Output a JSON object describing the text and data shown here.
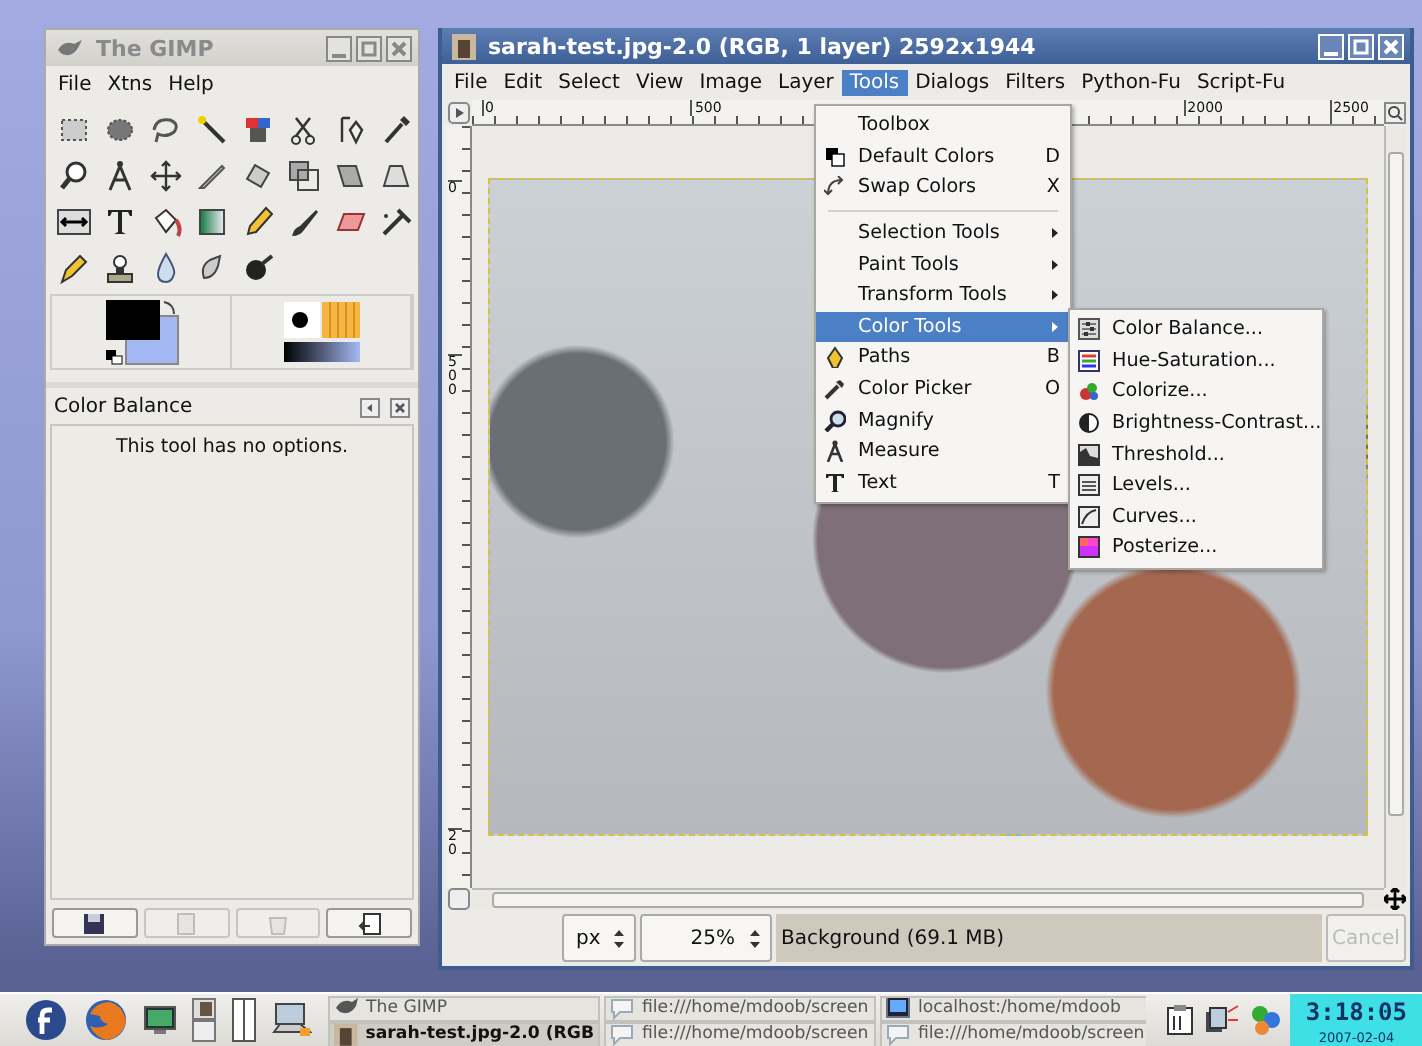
{
  "toolbox": {
    "title": "The GIMP",
    "menu": [
      "File",
      "Xtns",
      "Help"
    ],
    "options_panel": {
      "title": "Color Balance",
      "message": "This tool has no options."
    },
    "buttons": [
      {
        "disabled": false
      },
      {
        "disabled": true
      },
      {
        "disabled": true
      },
      {
        "disabled": false
      }
    ]
  },
  "image_window": {
    "title": "sarah-test.jpg-2.0 (RGB, 1 layer) 2592x1944",
    "menu": [
      {
        "label": "File",
        "selected": false
      },
      {
        "label": "Edit",
        "selected": false
      },
      {
        "label": "Select",
        "selected": false
      },
      {
        "label": "View",
        "selected": false
      },
      {
        "label": "Image",
        "selected": false
      },
      {
        "label": "Layer",
        "selected": false
      },
      {
        "label": "Tools",
        "selected": true
      },
      {
        "label": "Dialogs",
        "selected": false
      },
      {
        "label": "Filters",
        "selected": false
      },
      {
        "label": "Python-Fu",
        "selected": false
      },
      {
        "label": "Script-Fu",
        "selected": false
      }
    ],
    "top_ruler": [
      "0",
      "500",
      "2000",
      "2500"
    ],
    "left_ruler": [
      "0",
      "500",
      "20"
    ],
    "status_bar": {
      "unit": "px",
      "zoom": "25%",
      "layer": "Background (69.1 MB)",
      "cancel": {
        "label": "Cancel",
        "disabled": true
      }
    }
  },
  "tools_menu": [
    {
      "kind": "item",
      "label": "Toolbox",
      "submenu": false,
      "selected": false
    },
    {
      "kind": "item",
      "label": "Default Colors",
      "shortcut": "D",
      "submenu": false,
      "selected": false
    },
    {
      "kind": "item",
      "label": "Swap Colors",
      "shortcut": "X",
      "submenu": false,
      "selected": false
    },
    {
      "kind": "separator"
    },
    {
      "kind": "item",
      "label": "Selection Tools",
      "submenu": true,
      "selected": false
    },
    {
      "kind": "item",
      "label": "Paint Tools",
      "submenu": true,
      "selected": false
    },
    {
      "kind": "item",
      "label": "Transform Tools",
      "submenu": true,
      "selected": false
    },
    {
      "kind": "item",
      "label": "Color Tools",
      "submenu": true,
      "selected": true
    },
    {
      "kind": "item",
      "label": "Paths",
      "shortcut": "B",
      "submenu": false,
      "selected": false
    },
    {
      "kind": "item",
      "label": "Color Picker",
      "shortcut": "O",
      "submenu": false,
      "selected": false
    },
    {
      "kind": "item",
      "label": "Magnify",
      "submenu": false,
      "selected": false
    },
    {
      "kind": "item",
      "label": "Measure",
      "submenu": false,
      "selected": false
    },
    {
      "kind": "item",
      "label": "Text",
      "shortcut": "T",
      "submenu": false,
      "selected": false
    }
  ],
  "color_tools_submenu": [
    "Color Balance...",
    "Hue-Saturation...",
    "Colorize...",
    "Brightness-Contrast...",
    "Threshold...",
    "Levels...",
    "Curves...",
    "Posterize..."
  ],
  "taskbar": {
    "tasks": [
      {
        "label": "The GIMP",
        "selected": false
      },
      {
        "label": "file:///home/mdoob/screen",
        "selected": false
      },
      {
        "label": "localhost:/home/mdoob",
        "selected": false
      },
      {
        "label": "sarah-test.jpg-2.0 (RGB",
        "selected": true
      },
      {
        "label": "file:///home/mdoob/screen",
        "selected": false
      },
      {
        "label": "file:///home/mdoob/screen",
        "selected": false
      }
    ],
    "clock": {
      "time": "3:18:05",
      "date": "2007-02-04"
    }
  }
}
